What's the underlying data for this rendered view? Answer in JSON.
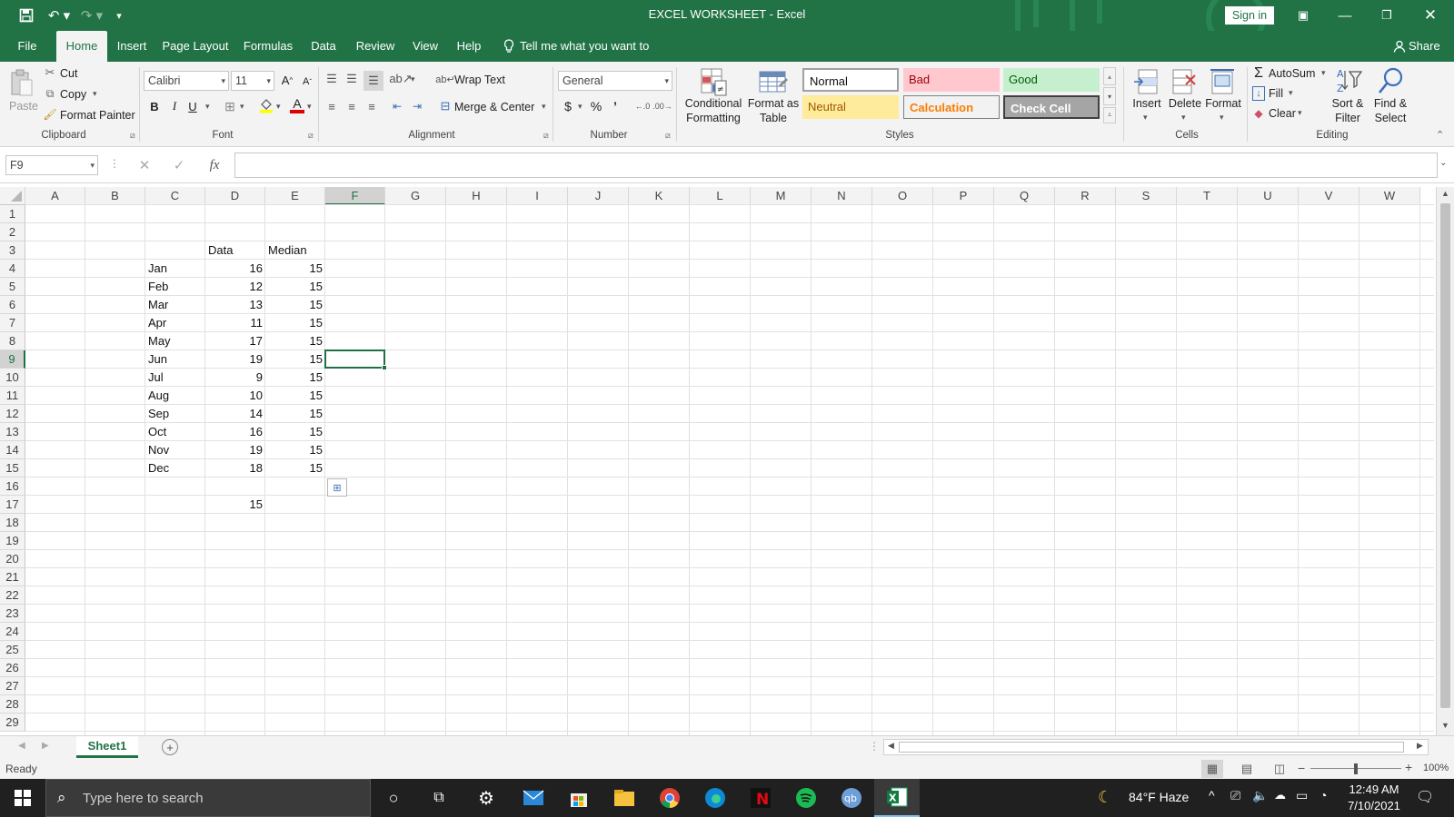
{
  "titlebar": {
    "title": "EXCEL WORKSHEET  -  Excel",
    "sign_in": "Sign in"
  },
  "tabs": {
    "file": "File",
    "home": "Home",
    "insert": "Insert",
    "page_layout": "Page Layout",
    "formulas": "Formulas",
    "data": "Data",
    "review": "Review",
    "view": "View",
    "help": "Help",
    "tell_me": "Tell me what you want to do",
    "share": "Share"
  },
  "ribbon": {
    "clipboard": {
      "paste": "Paste",
      "cut": "Cut",
      "copy": "Copy",
      "format_painter": "Format Painter",
      "label": "Clipboard"
    },
    "font": {
      "name": "Calibri",
      "size": "11",
      "bold": "B",
      "italic": "I",
      "underline": "U",
      "label": "Font"
    },
    "alignment": {
      "wrap": "Wrap Text",
      "merge": "Merge & Center",
      "label": "Alignment"
    },
    "number": {
      "format": "General",
      "currency": "$",
      "percent": "%",
      "comma": "’",
      "label": "Number"
    },
    "styles": {
      "conditional": [
        "Conditional",
        "Formatting"
      ],
      "format_as_table": [
        "Format as",
        "Table"
      ],
      "normal": "Normal",
      "bad": "Bad",
      "good": "Good",
      "neutral": "Neutral",
      "calculation": "Calculation",
      "check_cell": "Check Cell",
      "label": "Styles"
    },
    "cells": {
      "insert": "Insert",
      "delete": "Delete",
      "format": "Format",
      "label": "Cells"
    },
    "editing": {
      "autosum": "AutoSum",
      "fill": "Fill",
      "clear": "Clear",
      "sort": [
        "Sort &",
        "Filter"
      ],
      "find": [
        "Find &",
        "Select"
      ],
      "label": "Editing"
    }
  },
  "formula_bar": {
    "name_box": "F9",
    "fx": "fx",
    "value": ""
  },
  "columns": [
    "A",
    "B",
    "C",
    "D",
    "E",
    "F",
    "G",
    "H",
    "I",
    "J",
    "K",
    "L",
    "M",
    "N",
    "O",
    "P",
    "Q",
    "R",
    "S",
    "T",
    "U",
    "V",
    "W"
  ],
  "rows": [
    "1",
    "2",
    "3",
    "4",
    "5",
    "6",
    "7",
    "8",
    "9",
    "10",
    "11",
    "12",
    "13",
    "14",
    "15",
    "16",
    "17",
    "18",
    "19",
    "20",
    "21",
    "22",
    "23",
    "24",
    "25",
    "26",
    "27",
    "28",
    "29"
  ],
  "table": {
    "header_data": "Data",
    "header_median": "Median",
    "months": [
      "Jan",
      "Feb",
      "Mar",
      "Apr",
      "May",
      "Jun",
      "Jul",
      "Aug",
      "Sep",
      "Oct",
      "Nov",
      "Dec"
    ],
    "data": [
      "16",
      "12",
      "13",
      "11",
      "17",
      "19",
      "9",
      "10",
      "14",
      "16",
      "19",
      "18"
    ],
    "median": [
      "15",
      "15",
      "15",
      "15",
      "15",
      "15",
      "15",
      "15",
      "15",
      "15",
      "15",
      "15"
    ],
    "d17": "15"
  },
  "selected_cell": "F9",
  "sheet_tabs": [
    "Sheet1"
  ],
  "status": {
    "ready": "Ready",
    "zoom": "100%"
  },
  "taskbar": {
    "search_placeholder": "Type here to search",
    "weather": "84°F  Haze",
    "time": "12:49 AM",
    "date": "7/10/2021"
  },
  "colors": {
    "excel_green": "#217346",
    "selection": "#1e7145"
  }
}
